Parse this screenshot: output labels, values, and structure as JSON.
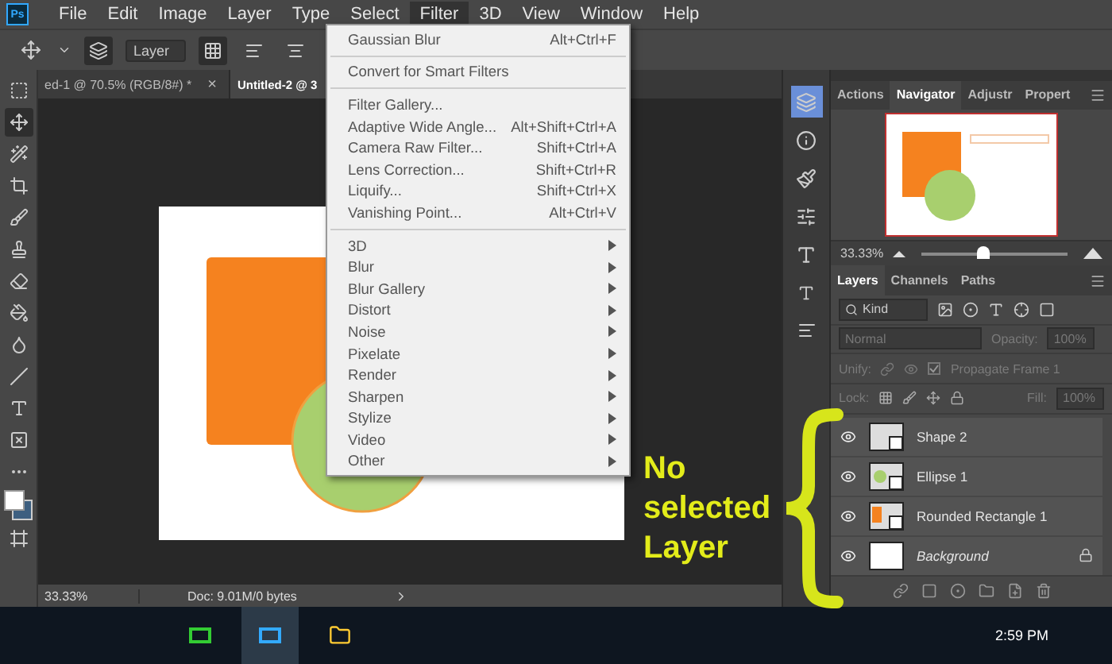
{
  "app_logo": "Ps",
  "menu": [
    {
      "label": "File",
      "selected": false
    },
    {
      "label": "Edit",
      "selected": false
    },
    {
      "label": "Image",
      "selected": false
    },
    {
      "label": "Layer",
      "selected": false
    },
    {
      "label": "Type",
      "selected": false
    },
    {
      "label": "Select",
      "selected": false
    },
    {
      "label": "Filter",
      "selected": true
    },
    {
      "label": "3D",
      "selected": false
    },
    {
      "label": "View",
      "selected": false
    },
    {
      "label": "Window",
      "selected": false
    },
    {
      "label": "Help",
      "selected": false
    }
  ],
  "options_bar": {
    "layer_select": "Layer"
  },
  "doc_tabs": [
    {
      "label": "ed-1 @ 70.5% (RGB/8#) *",
      "close": "×",
      "selected": false
    },
    {
      "label": "Untitled-2 @ 3",
      "selected": true
    }
  ],
  "tools": [
    {
      "kind": "marquee",
      "selected": false
    },
    {
      "kind": "move",
      "selected": true
    },
    {
      "kind": "wand",
      "selected": false
    },
    {
      "kind": "crop",
      "selected": false
    },
    {
      "kind": "brush",
      "selected": false
    },
    {
      "kind": "stamp",
      "selected": false
    },
    {
      "kind": "eraser",
      "selected": false
    },
    {
      "kind": "bucket",
      "selected": false
    },
    {
      "kind": "drop",
      "selected": false
    },
    {
      "kind": "line",
      "selected": false
    },
    {
      "kind": "type",
      "selected": false
    },
    {
      "kind": "frame",
      "selected": false
    },
    {
      "kind": "more",
      "selected": false
    }
  ],
  "filter_menu": {
    "sections": [
      [
        {
          "label": "Gaussian Blur",
          "shortcut": "Alt+Ctrl+F"
        }
      ],
      [
        {
          "label": "Convert for Smart Filters"
        }
      ],
      [
        {
          "label": "Filter Gallery..."
        },
        {
          "label": "Adaptive Wide Angle...",
          "shortcut": "Alt+Shift+Ctrl+A"
        },
        {
          "label": "Camera Raw Filter...",
          "shortcut": "Shift+Ctrl+A"
        },
        {
          "label": "Lens Correction...",
          "shortcut": "Shift+Ctrl+R"
        },
        {
          "label": "Liquify...",
          "shortcut": "Shift+Ctrl+X"
        },
        {
          "label": "Vanishing Point...",
          "shortcut": "Alt+Ctrl+V"
        }
      ],
      [
        {
          "label": "3D",
          "submenu": true
        },
        {
          "label": "Blur",
          "submenu": true
        },
        {
          "label": "Blur Gallery",
          "submenu": true
        },
        {
          "label": "Distort",
          "submenu": true
        },
        {
          "label": "Noise",
          "submenu": true
        },
        {
          "label": "Pixelate",
          "submenu": true
        },
        {
          "label": "Render",
          "submenu": true
        },
        {
          "label": "Sharpen",
          "submenu": true
        },
        {
          "label": "Stylize",
          "submenu": true
        },
        {
          "label": "Video",
          "submenu": true
        },
        {
          "label": "Other",
          "submenu": true
        }
      ]
    ]
  },
  "navigator_panel": {
    "tabs": [
      {
        "label": "Actions",
        "selected": false
      },
      {
        "label": "Navigator",
        "selected": true
      },
      {
        "label": "Adjustr",
        "selected": false
      },
      {
        "label": "Propert",
        "selected": false
      }
    ],
    "zoom": "33.33%",
    "level": 0.42
  },
  "layers_panel": {
    "tabs": [
      {
        "label": "Layers",
        "selected": true
      },
      {
        "label": "Channels",
        "selected": false
      },
      {
        "label": "Paths",
        "selected": false
      }
    ],
    "filter": "Kind",
    "blend_mode": "Normal",
    "opacity_label": "Opacity:",
    "opacity": "100%",
    "unify_label": "Unify:",
    "propagate": "Propagate Frame 1",
    "propagate_checked": true,
    "lock_label": "Lock:",
    "fill_label": "Fill:",
    "fill": "100%",
    "layers": [
      {
        "name": "Shape 2",
        "kind": "shape",
        "visible": true,
        "selected": false
      },
      {
        "name": "Ellipse 1",
        "kind": "ellipse",
        "visible": true,
        "selected": false
      },
      {
        "name": "Rounded Rectangle 1",
        "kind": "rect",
        "visible": true,
        "selected": false
      },
      {
        "name": "Background",
        "kind": "background",
        "visible": true,
        "selected": false
      }
    ]
  },
  "status_bar": {
    "zoom": "33.33%",
    "doc": "Doc: 9.01M/0 bytes"
  },
  "taskbar": {
    "time": "2:59 PM"
  },
  "annotation": {
    "lines": [
      "No",
      "selected",
      "Layer"
    ]
  }
}
